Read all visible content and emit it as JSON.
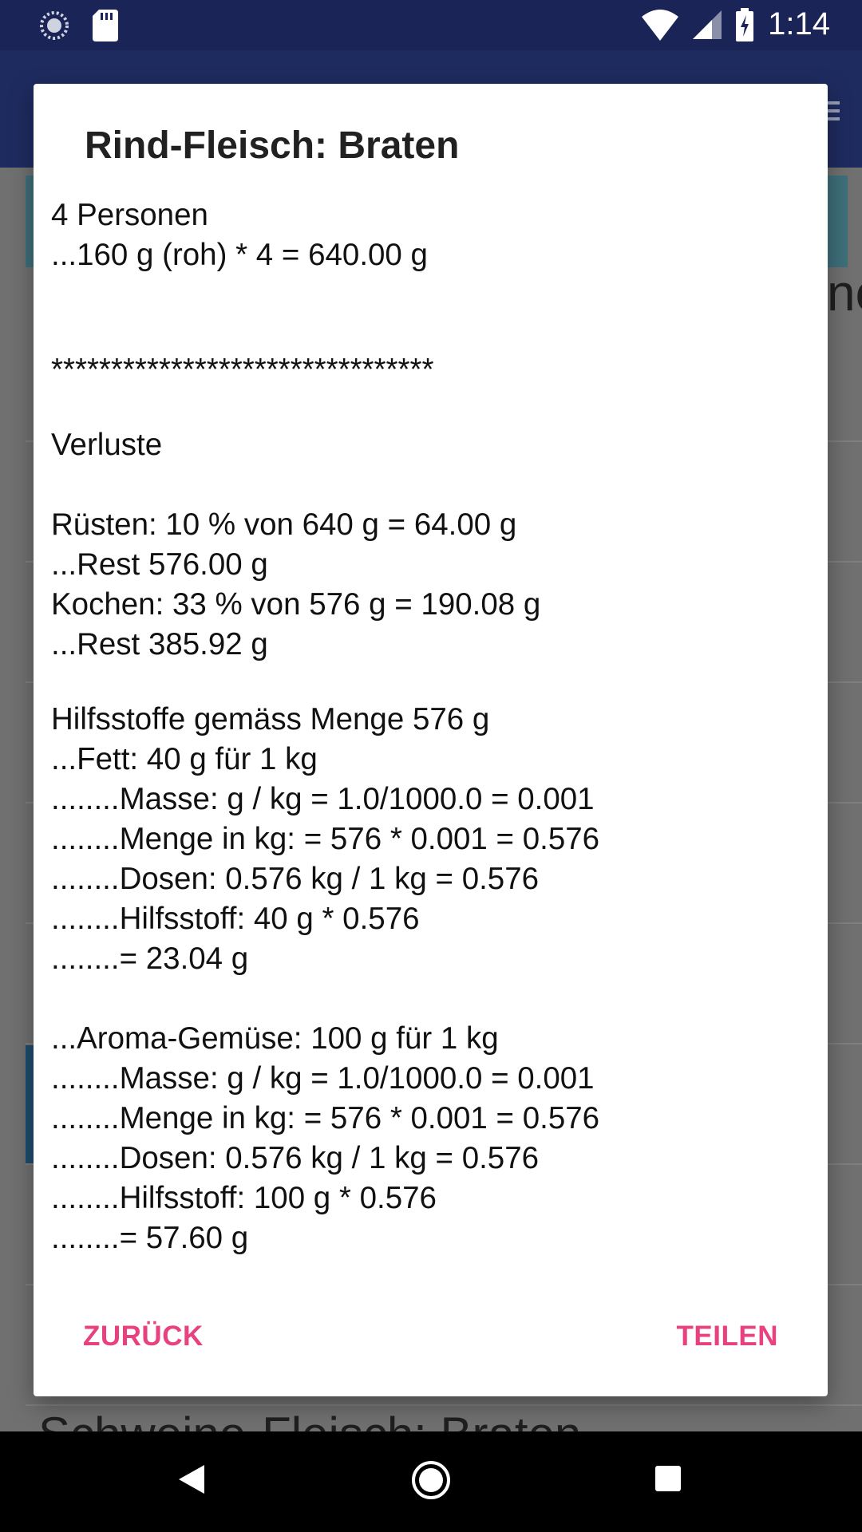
{
  "status_bar": {
    "time": "1:14",
    "icons": [
      "sync-spinner-icon",
      "sd-card-icon",
      "wifi-icon",
      "signal-icon",
      "battery-charging-icon"
    ]
  },
  "background": {
    "side_text": "no",
    "bottom_text": "Schweine-Fleisch: Braten"
  },
  "dialog": {
    "title": "Rind-Fleisch: Braten",
    "lines": {
      "persons": "4 Personen",
      "amount": "...160 g (roh) * 4 = 640.00 g",
      "separator": "********************************",
      "losses_header": "Verluste",
      "prep": "Rüsten: 10 % von 640 g = 64.00 g",
      "prep_rest": "...Rest 576.00 g",
      "cook": "Kochen: 33 % von 576 g = 190.08 g",
      "cook_rest": "...Rest 385.92 g",
      "aux_header": "Hilfsstoffe gemäss Menge 576 g",
      "fat_header": "...Fett: 40 g für 1 kg",
      "fat_mass": "........Masse: g / kg = 1.0/1000.0 = 0.001",
      "fat_qty": "........Menge in kg: = 576 * 0.001 = 0.576",
      "fat_doses": "........Dosen: 0.576 kg / 1 kg = 0.576",
      "fat_aux": "........Hilfsstoff: 40 g * 0.576",
      "fat_result": "........= 23.04 g",
      "veg_header": "...Aroma-Gemüse: 100 g für 1 kg",
      "veg_mass": "........Masse: g / kg = 1.0/1000.0 = 0.001",
      "veg_qty": "........Menge in kg: = 576 * 0.001 = 0.576",
      "veg_doses": "........Dosen: 0.576 kg / 1 kg = 0.576",
      "veg_aux": "........Hilfsstoff: 100 g * 0.576",
      "veg_result": "........= 57.60 g"
    },
    "back_label": "ZURÜCK",
    "share_label": "TEILEN",
    "accent_color": "#e8417f"
  },
  "nav_bar": {
    "icons": [
      "back-triangle-icon",
      "home-circle-icon",
      "recents-square-icon"
    ]
  }
}
